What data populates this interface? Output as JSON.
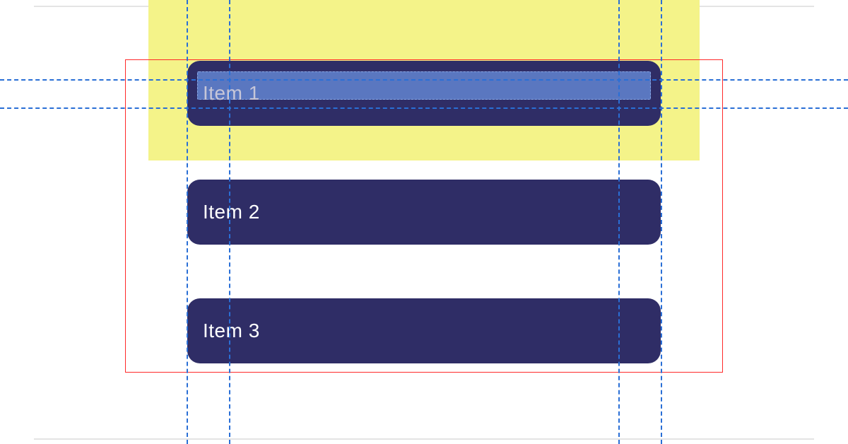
{
  "items": [
    {
      "label": "Item 1"
    },
    {
      "label": "Item 2"
    },
    {
      "label": "Item 3"
    }
  ],
  "colors": {
    "item_bg": "#2f2d66",
    "highlight": "#f4f389",
    "guide": "#2a6fd6",
    "bounds": "#ff2a2a",
    "selection": "#5a77c0"
  }
}
